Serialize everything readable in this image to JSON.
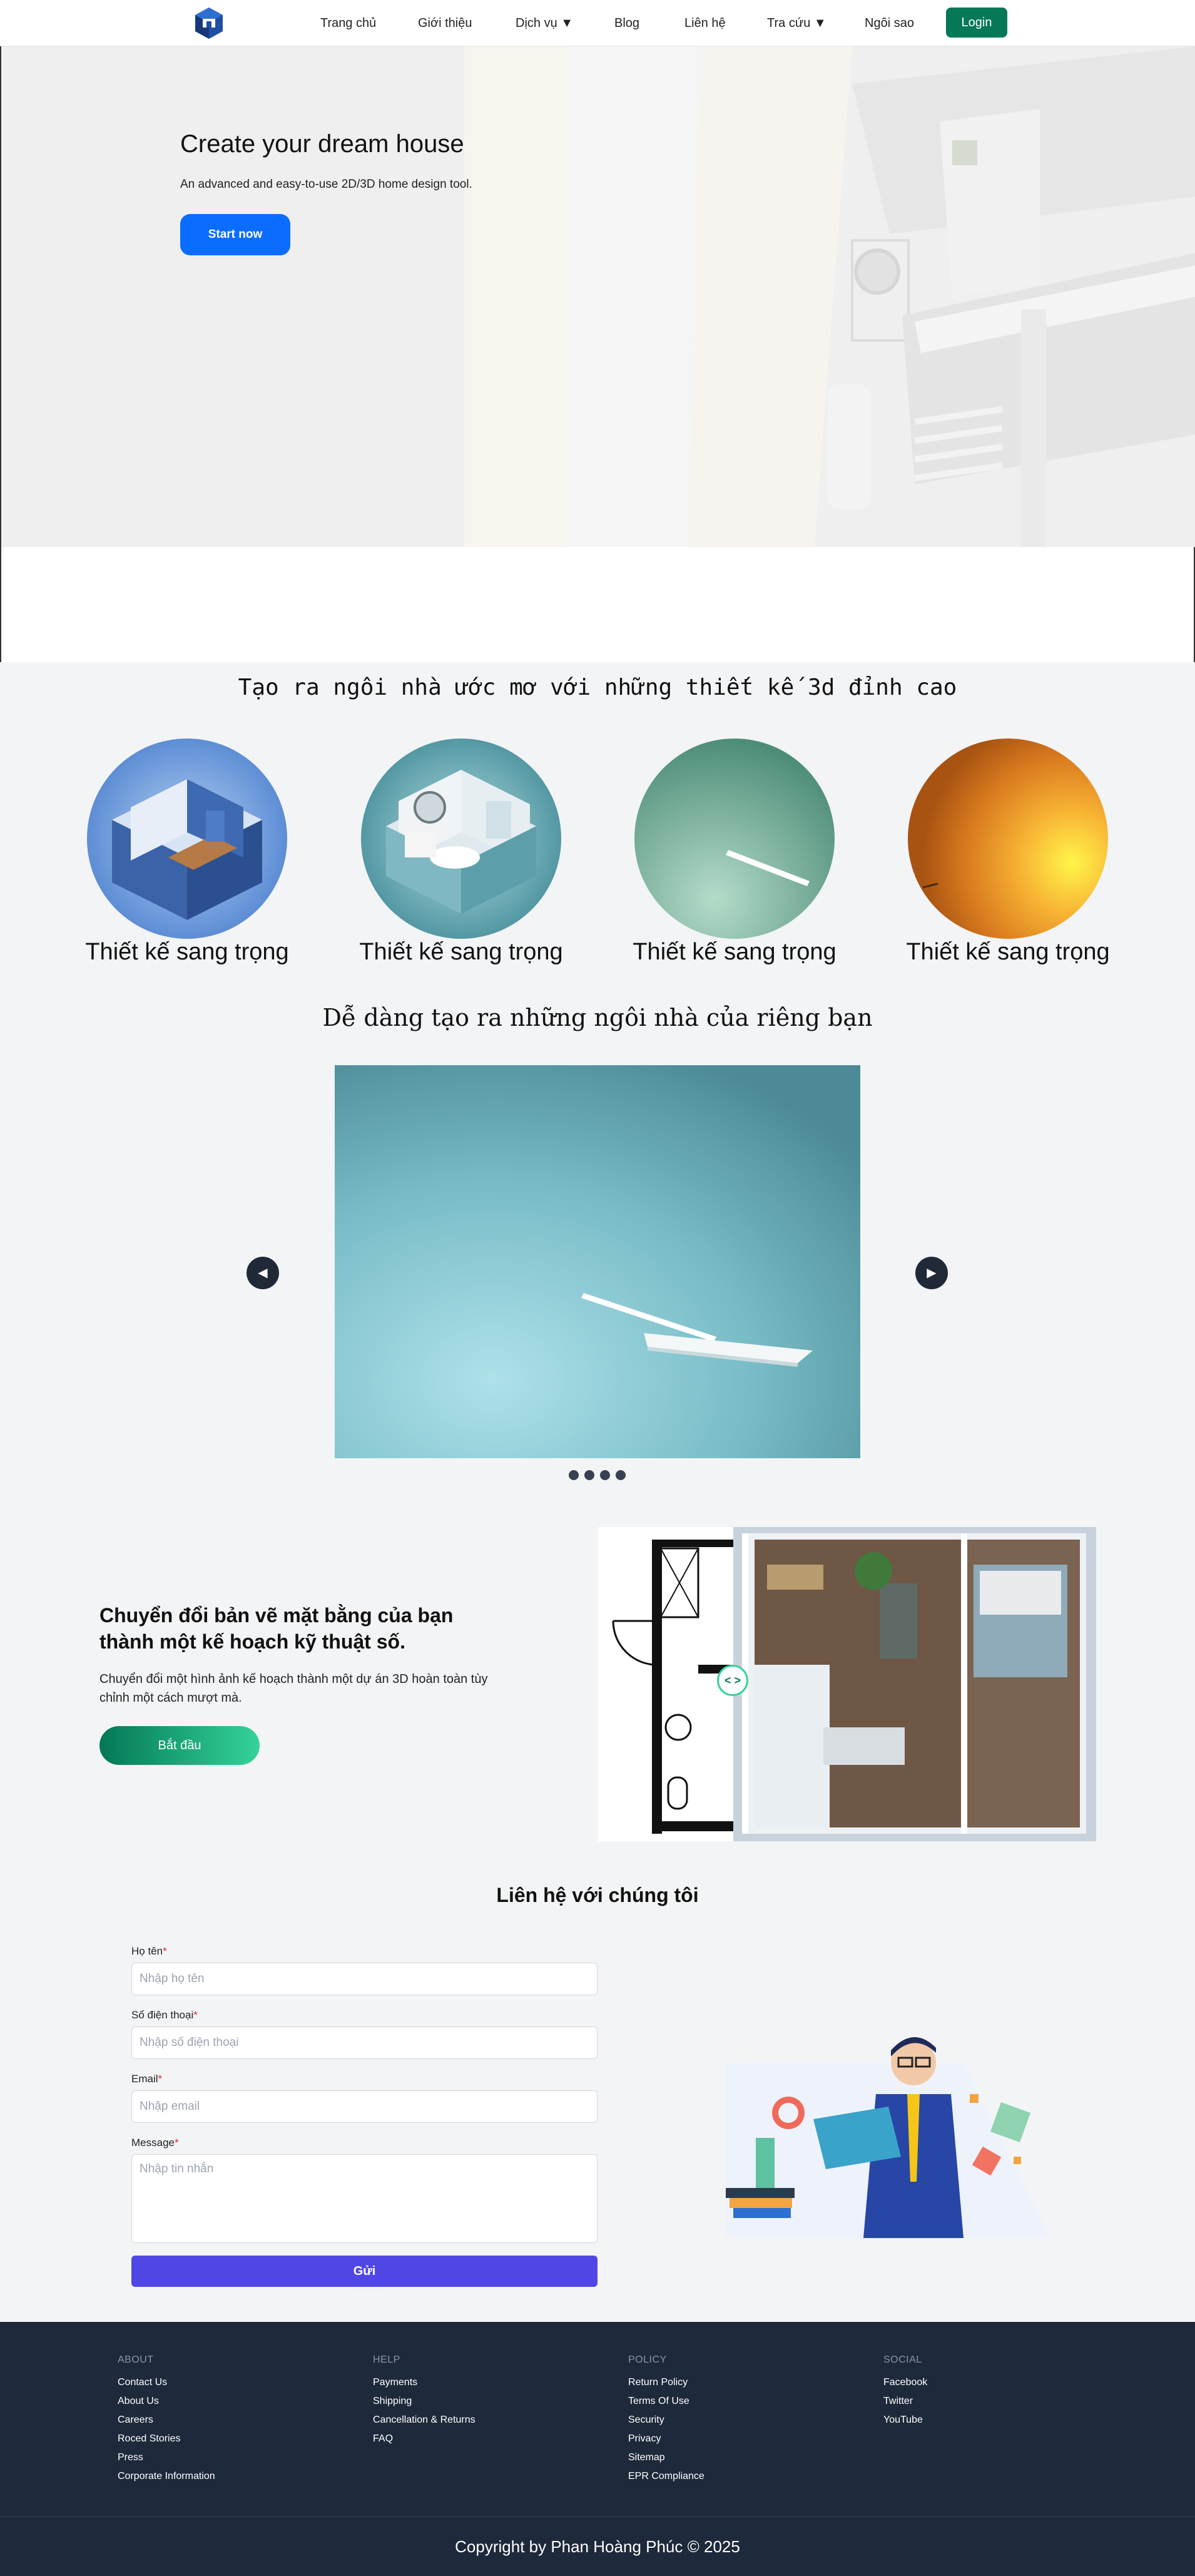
{
  "nav": {
    "items": [
      "Trang chủ",
      "Giới thiệu",
      "Dịch vụ ▼",
      "Blog",
      "Liên hệ",
      "Tra cứu ▼",
      "Ngôi sao"
    ],
    "login": "Login"
  },
  "hero": {
    "title": "Create your dream house",
    "subtitle": "An advanced and easy-to-use 2D/3D home design tool.",
    "cta": "Start now"
  },
  "section1": {
    "title": "Tạo ra ngôi nhà ước mơ với những thiết kế 3d đỉnh cao",
    "cards": [
      "Thiết kế sang trọng",
      "Thiết kế sang trọng",
      "Thiết kế sang trọng",
      "Thiết kế sang trọng"
    ]
  },
  "section2": {
    "title": "Dễ dàng tạo ra những ngôi nhà của riêng bạn",
    "prev": "◀",
    "next": "▶",
    "dots": 4
  },
  "floorplan": {
    "title": "Chuyển đổi bản vẽ mặt bằng của bạn thành một kế hoạch kỹ thuật số.",
    "desc": "Chuyển đổi một hình ảnh kế hoạch thành một dự án 3D hoàn toàn tùy chỉnh một cách mượt mà.",
    "cta": "Bắt đầu",
    "handle": "< >"
  },
  "contact": {
    "title": "Liên hệ với chúng tôi",
    "name_label": "Họ tên",
    "name_placeholder": "Nhập họ tên",
    "phone_label": "Số điện thoại",
    "phone_placeholder": "Nhập số điện thoại",
    "email_label": "Email",
    "email_placeholder": "Nhập email",
    "message_label": "Message",
    "message_placeholder": "Nhập tin nhắn",
    "required_mark": "*",
    "submit": "Gửi"
  },
  "footer": {
    "columns": [
      {
        "heading": "ABOUT",
        "links": [
          "Contact Us",
          "About Us",
          "Careers",
          "Roced Stories",
          "Press",
          "Corporate Information"
        ]
      },
      {
        "heading": "HELP",
        "links": [
          "Payments",
          "Shipping",
          "Cancellation & Returns",
          "FAQ"
        ]
      },
      {
        "heading": "POLICY",
        "links": [
          "Return Policy",
          "Terms Of Use",
          "Security",
          "Privacy",
          "Sitemap",
          "EPR Compliance"
        ]
      },
      {
        "heading": "SOCIAL",
        "links": [
          "Facebook",
          "Twitter",
          "YouTube"
        ]
      }
    ],
    "copyright": "Copyright by Phan Hoàng Phúc © 2025"
  },
  "colors": {
    "login": "#047857",
    "start": "#0b6dff",
    "submit": "#4f46e5",
    "footer": "#1e293b"
  }
}
